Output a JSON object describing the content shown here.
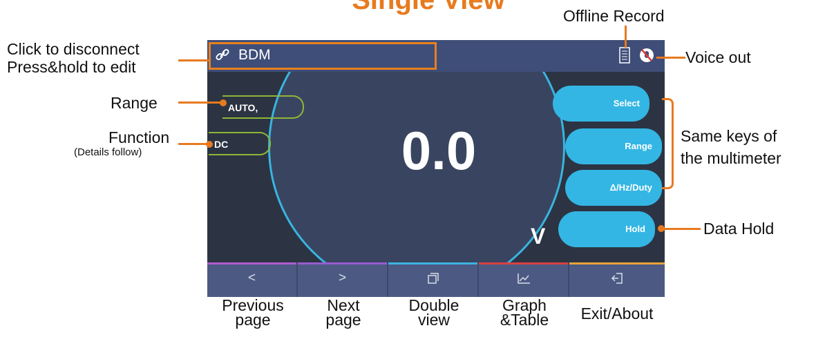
{
  "page_title": "Single View",
  "app": {
    "name": "BDM"
  },
  "display": {
    "reading": "0.0",
    "unit": "V",
    "range_tag": "AUTO,",
    "function_tag": "DC"
  },
  "keys": {
    "select": "Select",
    "range": "Range",
    "delta": "Δ/Hz/Duty",
    "hold": "Hold"
  },
  "bottom_nav": {
    "prev": "<",
    "next": ">"
  },
  "annotations": {
    "disconnect": "Click to disconnect",
    "edit": "Press&hold to edit",
    "range": "Range",
    "function": "Function",
    "function_note": "(Details follow)",
    "offline_record": "Offline Record",
    "voice_out": "Voice out",
    "same_keys_1": "Same keys of",
    "same_keys_2": "the multimeter",
    "data_hold": "Data Hold"
  },
  "captions": {
    "prev_1": "Previous",
    "prev_2": "page",
    "next_1": "Next",
    "next_2": "page",
    "double_1": "Double",
    "double_2": "view",
    "graph_1": "Graph",
    "graph_2": "&Table",
    "exit": "Exit/About"
  },
  "colors": {
    "accent": "#e87a1e",
    "key_blue": "#34b6e4",
    "screen_bg": "#2c3443",
    "bar_bg": "#3f4e78"
  }
}
